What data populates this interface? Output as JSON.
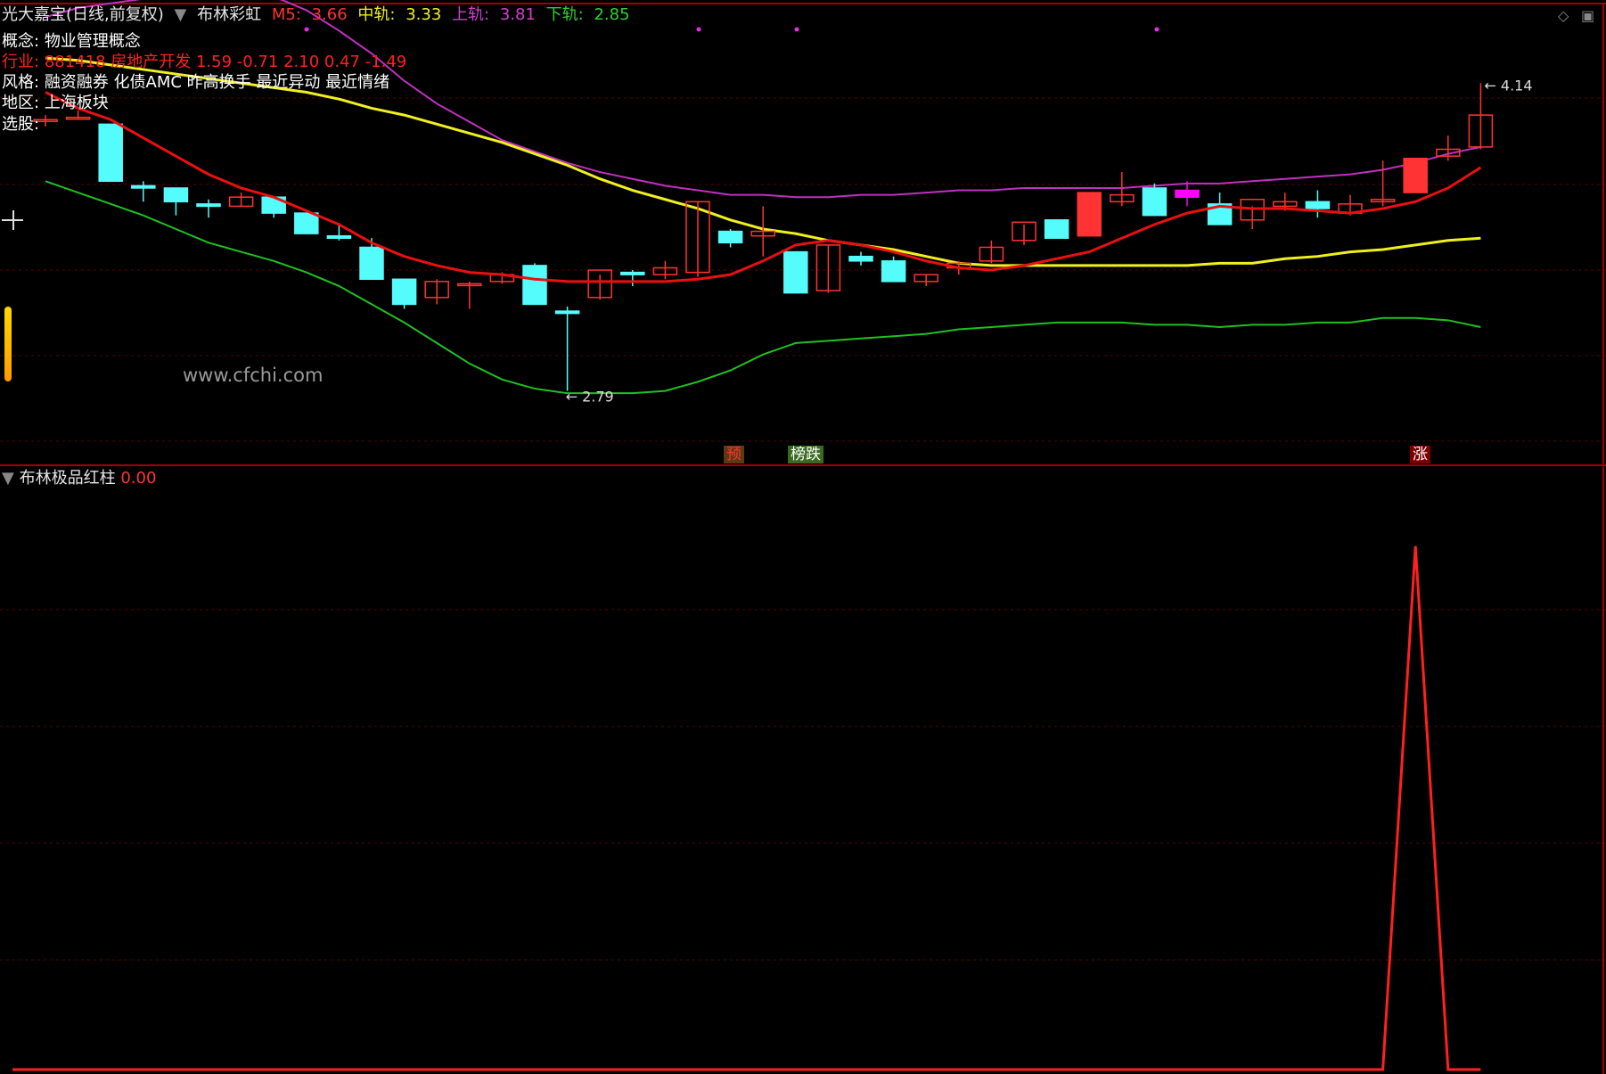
{
  "header": {
    "stock_title": "光大嘉宝(日线,前复权)",
    "indicator_name": "布林彩虹",
    "m5_label": "M5:",
    "m5_value": "3.66",
    "mid_label": "中轨:",
    "mid_value": "3.33",
    "upper_label": "上轨:",
    "upper_value": "3.81",
    "lower_label": "下轨:",
    "lower_value": "2.85"
  },
  "info": {
    "concept_label": "概念:",
    "concept_value": "物业管理概念",
    "industry_label": "行业:",
    "industry_value": "881418 房地产开发 1.59 -0.71 2.10 0.47 -1.49",
    "style_label": "风格:",
    "style_value": "融资融券 化债AMC 昨高换手 最近异动 最近情绪",
    "region_label": "地区:",
    "region_value": "上海板块",
    "pick_label": "选股:"
  },
  "watermark": "www.cfchi.com",
  "price_annotations": {
    "high": "4.14",
    "low": "2.79"
  },
  "signals": [
    {
      "text": "预",
      "color": "#ff3333",
      "bg": "#5a3a10"
    },
    {
      "text": "榜跌",
      "color": "#ffffff",
      "bg": "#3a6a20"
    },
    {
      "text": "涨",
      "color": "#ffffff",
      "bg": "#7a0000"
    }
  ],
  "sub_panel": {
    "indicator_name": "布林极品红柱",
    "value": "0.00"
  },
  "colors": {
    "up": "#ff3333",
    "down": "#54fcfc",
    "m5": "#e81010",
    "mid": "#f0f020",
    "upper": "#c030c0",
    "lower": "#20c020",
    "grid": "#5a0000"
  },
  "chart_data": {
    "type": "candlestick",
    "y_range": [
      2.55,
      4.45
    ],
    "candles": [
      {
        "o": 3.98,
        "h": 4.0,
        "l": 3.95,
        "c": 3.98
      },
      {
        "o": 3.99,
        "h": 4.02,
        "l": 3.98,
        "c": 3.99
      },
      {
        "o": 3.96,
        "h": 3.96,
        "l": 3.71,
        "c": 3.71
      },
      {
        "o": 3.69,
        "h": 3.71,
        "l": 3.62,
        "c": 3.68
      },
      {
        "o": 3.68,
        "h": 3.68,
        "l": 3.56,
        "c": 3.62
      },
      {
        "o": 3.61,
        "h": 3.63,
        "l": 3.55,
        "c": 3.6
      },
      {
        "o": 3.6,
        "h": 3.66,
        "l": 3.6,
        "c": 3.64
      },
      {
        "o": 3.64,
        "h": 3.64,
        "l": 3.55,
        "c": 3.57
      },
      {
        "o": 3.57,
        "h": 3.57,
        "l": 3.48,
        "c": 3.48
      },
      {
        "o": 3.47,
        "h": 3.52,
        "l": 3.45,
        "c": 3.46
      },
      {
        "o": 3.42,
        "h": 3.46,
        "l": 3.28,
        "c": 3.28
      },
      {
        "o": 3.28,
        "h": 3.28,
        "l": 3.15,
        "c": 3.17
      },
      {
        "o": 3.2,
        "h": 3.28,
        "l": 3.17,
        "c": 3.27
      },
      {
        "o": 3.26,
        "h": 3.27,
        "l": 3.15,
        "c": 3.26
      },
      {
        "o": 3.27,
        "h": 3.31,
        "l": 3.26,
        "c": 3.3
      },
      {
        "o": 3.34,
        "h": 3.35,
        "l": 3.17,
        "c": 3.17
      },
      {
        "o": 3.14,
        "h": 3.16,
        "l": 2.79,
        "c": 3.13
      },
      {
        "o": 3.2,
        "h": 3.3,
        "l": 3.19,
        "c": 3.32
      },
      {
        "o": 3.31,
        "h": 3.32,
        "l": 3.25,
        "c": 3.3
      },
      {
        "o": 3.3,
        "h": 3.36,
        "l": 3.28,
        "c": 3.33
      },
      {
        "o": 3.31,
        "h": 3.62,
        "l": 3.29,
        "c": 3.62
      },
      {
        "o": 3.49,
        "h": 3.5,
        "l": 3.42,
        "c": 3.44
      },
      {
        "o": 3.47,
        "h": 3.6,
        "l": 3.38,
        "c": 3.49
      },
      {
        "o": 3.4,
        "h": 3.4,
        "l": 3.22,
        "c": 3.22
      },
      {
        "o": 3.23,
        "h": 3.43,
        "l": 3.22,
        "c": 3.43
      },
      {
        "o": 3.38,
        "h": 3.4,
        "l": 3.34,
        "c": 3.36
      },
      {
        "o": 3.36,
        "h": 3.38,
        "l": 3.27,
        "c": 3.27
      },
      {
        "o": 3.27,
        "h": 3.3,
        "l": 3.25,
        "c": 3.3
      },
      {
        "o": 3.33,
        "h": 3.36,
        "l": 3.3,
        "c": 3.35
      },
      {
        "o": 3.36,
        "h": 3.45,
        "l": 3.35,
        "c": 3.42
      },
      {
        "o": 3.45,
        "h": 3.52,
        "l": 3.43,
        "c": 3.53
      },
      {
        "o": 3.54,
        "h": 3.54,
        "l": 3.46,
        "c": 3.46
      },
      {
        "o": 3.47,
        "h": 3.66,
        "l": 3.47,
        "c": 3.66
      },
      {
        "o": 3.62,
        "h": 3.75,
        "l": 3.6,
        "c": 3.65
      },
      {
        "o": 3.68,
        "h": 3.7,
        "l": 3.56,
        "c": 3.56
      },
      {
        "o": 3.67,
        "h": 3.71,
        "l": 3.6,
        "c": 3.64,
        "highlight": true
      },
      {
        "o": 3.61,
        "h": 3.66,
        "l": 3.52,
        "c": 3.52
      },
      {
        "o": 3.54,
        "h": 3.6,
        "l": 3.5,
        "c": 3.63
      },
      {
        "o": 3.6,
        "h": 3.66,
        "l": 3.58,
        "c": 3.62
      },
      {
        "o": 3.62,
        "h": 3.67,
        "l": 3.55,
        "c": 3.59
      },
      {
        "o": 3.57,
        "h": 3.65,
        "l": 3.56,
        "c": 3.61
      },
      {
        "o": 3.62,
        "h": 3.8,
        "l": 3.6,
        "c": 3.63
      },
      {
        "o": 3.66,
        "h": 3.81,
        "l": 3.66,
        "c": 3.81
      },
      {
        "o": 3.82,
        "h": 3.91,
        "l": 3.8,
        "c": 3.85
      },
      {
        "o": 3.86,
        "h": 4.14,
        "l": 3.85,
        "c": 4.0
      }
    ],
    "m5": [
      4.1,
      4.03,
      3.98,
      3.9,
      3.82,
      3.74,
      3.68,
      3.64,
      3.58,
      3.52,
      3.44,
      3.38,
      3.34,
      3.31,
      3.3,
      3.28,
      3.27,
      3.27,
      3.27,
      3.27,
      3.28,
      3.3,
      3.36,
      3.43,
      3.45,
      3.43,
      3.4,
      3.36,
      3.33,
      3.32,
      3.34,
      3.37,
      3.4,
      3.46,
      3.52,
      3.57,
      3.6,
      3.59,
      3.59,
      3.58,
      3.57,
      3.59,
      3.62,
      3.68,
      3.77
    ],
    "mid": [
      4.25,
      4.24,
      4.22,
      4.2,
      4.18,
      4.16,
      4.14,
      4.12,
      4.1,
      4.07,
      4.03,
      4.0,
      3.96,
      3.92,
      3.88,
      3.83,
      3.78,
      3.72,
      3.67,
      3.63,
      3.59,
      3.54,
      3.5,
      3.48,
      3.45,
      3.43,
      3.41,
      3.38,
      3.35,
      3.34,
      3.34,
      3.34,
      3.34,
      3.34,
      3.34,
      3.34,
      3.35,
      3.35,
      3.37,
      3.38,
      3.4,
      3.41,
      3.43,
      3.45,
      3.46
    ],
    "upper": [
      4.43,
      4.47,
      4.49,
      4.51,
      4.53,
      4.54,
      4.54,
      4.52,
      4.46,
      4.37,
      4.27,
      4.15,
      4.05,
      3.97,
      3.89,
      3.84,
      3.79,
      3.75,
      3.72,
      3.69,
      3.67,
      3.65,
      3.65,
      3.64,
      3.64,
      3.65,
      3.65,
      3.66,
      3.67,
      3.67,
      3.68,
      3.68,
      3.68,
      3.68,
      3.69,
      3.7,
      3.7,
      3.71,
      3.72,
      3.73,
      3.74,
      3.76,
      3.79,
      3.83,
      3.86
    ],
    "lower": [
      3.71,
      3.66,
      3.61,
      3.56,
      3.5,
      3.44,
      3.4,
      3.36,
      3.31,
      3.25,
      3.17,
      3.09,
      3.0,
      2.91,
      2.84,
      2.8,
      2.78,
      2.78,
      2.78,
      2.79,
      2.83,
      2.88,
      2.95,
      3.0,
      3.01,
      3.02,
      3.03,
      3.04,
      3.06,
      3.07,
      3.08,
      3.09,
      3.09,
      3.09,
      3.08,
      3.08,
      3.07,
      3.08,
      3.08,
      3.09,
      3.09,
      3.11,
      3.11,
      3.1,
      3.07
    ],
    "sub_series": [
      0,
      0,
      0,
      0,
      0,
      0,
      0,
      0,
      0,
      0,
      0,
      0,
      0,
      0,
      0,
      0,
      0,
      0,
      0,
      0,
      0,
      0,
      0,
      0,
      0,
      0,
      0,
      0,
      0,
      0,
      0,
      0,
      0,
      0,
      0,
      0,
      0,
      0,
      0,
      0,
      0,
      0,
      1,
      0,
      0
    ],
    "sub_y_range": [
      0,
      1.1
    ]
  }
}
